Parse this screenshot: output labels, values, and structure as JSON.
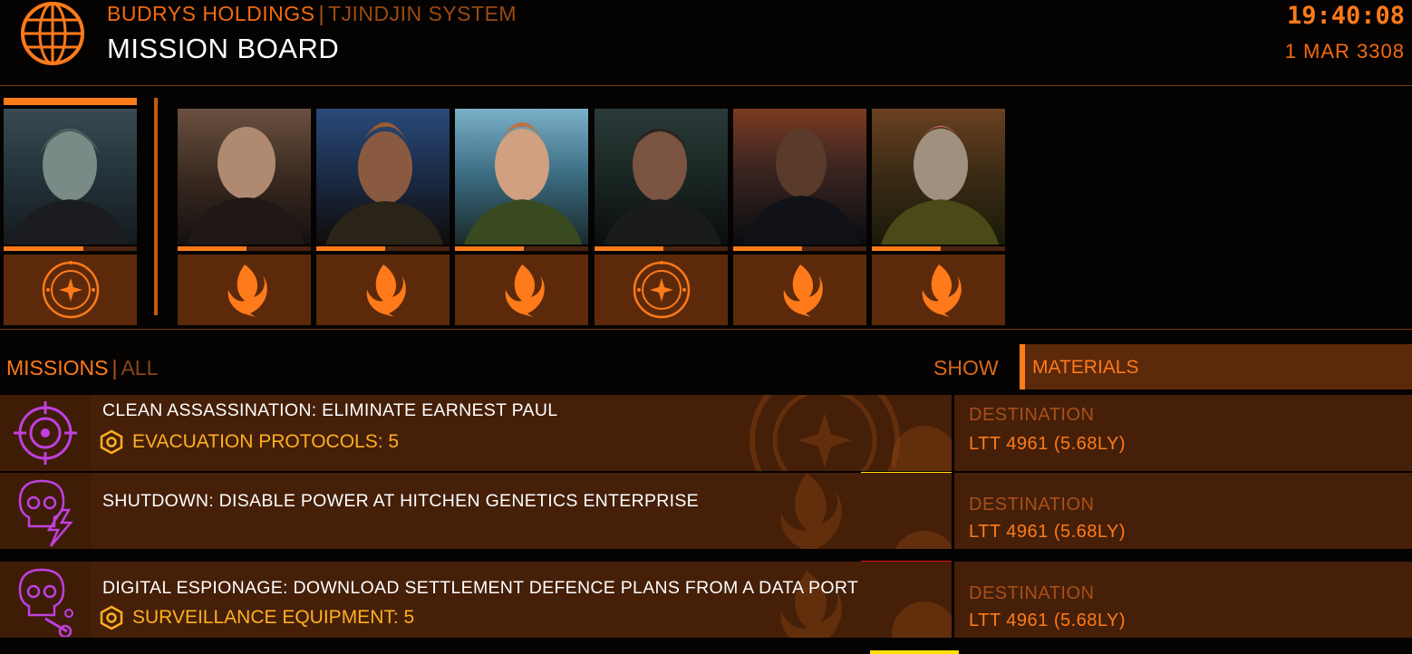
{
  "header": {
    "station": "BUDRYS HOLDINGS",
    "separator": "|",
    "system": "TJINDJIN SYSTEM",
    "title": "MISSION BOARD",
    "time": "19:40:08",
    "date": "1 MAR 3308"
  },
  "contacts": [
    {
      "faction_icon": "federation-icon",
      "selected": true,
      "reputation": 0.6
    },
    {
      "faction_icon": "independent-phoenix-icon",
      "selected": false,
      "reputation": 0.52
    },
    {
      "faction_icon": "independent-phoenix-icon",
      "selected": false,
      "reputation": 0.5
    },
    {
      "faction_icon": "independent-phoenix-icon",
      "selected": false,
      "reputation": 0.5
    },
    {
      "faction_icon": "federation-icon",
      "selected": false,
      "reputation": 0.5
    },
    {
      "faction_icon": "independent-phoenix-icon",
      "selected": false,
      "reputation": 0.5
    },
    {
      "faction_icon": "independent-phoenix-icon",
      "selected": false,
      "reputation": 0.5
    }
  ],
  "missions_header": {
    "label": "MISSIONS",
    "separator": "|",
    "filter": "ALL",
    "show_label": "SHOW",
    "show_value": "MATERIALS"
  },
  "missions": [
    {
      "icon": "assassination-target-icon",
      "name": "CLEAN ASSASSINATION: ELIMINATE EARNEST PAUL",
      "reward": "EVACUATION PROTOCOLS: 5",
      "dest_label": "DESTINATION",
      "destination": "LTT 4961 (5.68LY)"
    },
    {
      "icon": "skull-lightning-icon",
      "name": "SHUTDOWN: DISABLE POWER AT HITCHEN GENETICS ENTERPRISE",
      "reward": "",
      "dest_label": "DESTINATION",
      "destination": "LTT 4961 (5.68LY)"
    },
    {
      "icon": "skull-data-icon",
      "name": "DIGITAL ESPIONAGE: DOWNLOAD SETTLEMENT DEFENCE PLANS FROM A DATA PORT",
      "reward": "SURVEILLANCE EQUIPMENT: 5",
      "dest_label": "DESTINATION",
      "destination": "LTT 4961 (5.68LY)"
    }
  ],
  "colors": {
    "accent": "#ff7a1a",
    "mission_bg": "#451f08",
    "reward": "#ffb020",
    "mission_icon": "#c040e0",
    "risk_yellow": "#ffe000",
    "risk_red": "#e01010"
  }
}
